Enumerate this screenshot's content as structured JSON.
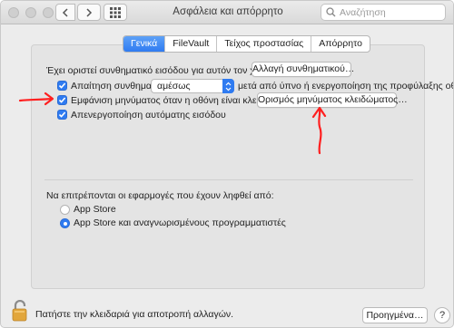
{
  "window": {
    "title": "Ασφάλεια και απόρρητο"
  },
  "search": {
    "placeholder": "Αναζήτηση"
  },
  "tabs": [
    {
      "label": "Γενικά",
      "active": true
    },
    {
      "label": "FileVault",
      "active": false
    },
    {
      "label": "Τείχος προστασίας",
      "active": false
    },
    {
      "label": "Απόρρητο",
      "active": false
    }
  ],
  "general": {
    "password_text": "Έχει οριστεί συνθηματικό εισόδου για αυτόν τον χρήστη",
    "change_password_button": "Αλλαγή συνθηματικού…",
    "require_password": {
      "label": "Απαίτηση συνθηματικού",
      "checked": true
    },
    "require_select": {
      "value": "αμέσως"
    },
    "require_suffix": "μετά από ύπνο ή ενεργοποίηση της προφύλαξης οθόνης",
    "show_message": {
      "label": "Εμφάνιση μηνύματος όταν η οθόνη είναι κλειδωμένη",
      "checked": true
    },
    "set_lock_message_button": "Ορισμός μηνύματος κλειδώματος…",
    "disable_auto_login": {
      "label": "Απενεργοποίηση αυτόματης εισόδου",
      "checked": true
    }
  },
  "apps": {
    "heading": "Να επιτρέπονται οι εφαρμογές που έχουν ληφθεί από:",
    "options": [
      {
        "label": "App Store",
        "selected": false
      },
      {
        "label": "App Store και αναγνωρισμένους προγραμματιστές",
        "selected": true
      }
    ]
  },
  "footer": {
    "lock_text": "Πατήστε την κλειδαριά για αποτροπή αλλαγών.",
    "advanced_button": "Προηγμένα…",
    "help_button": "?"
  },
  "colors": {
    "accent": "#2f7bf1",
    "annotation": "#ff1f1f"
  }
}
